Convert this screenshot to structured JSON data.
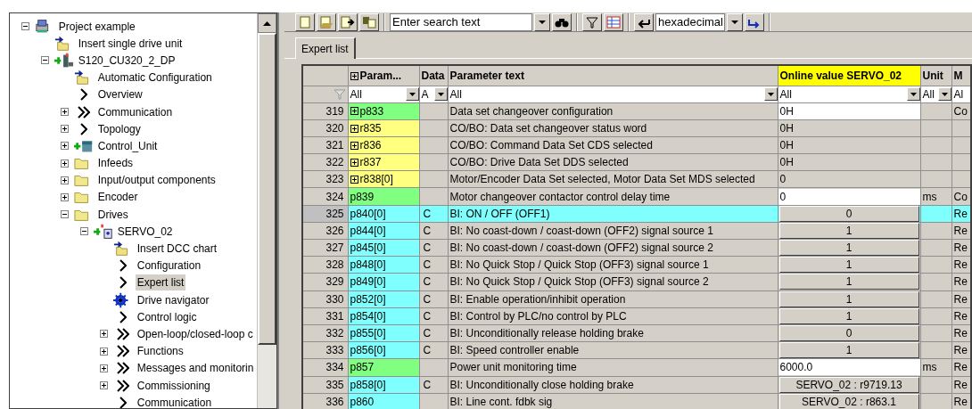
{
  "tree": [
    {
      "label": "Project example",
      "kind": "project",
      "expanded": true,
      "children": [
        {
          "label": "Insert single drive unit",
          "kind": "insert"
        },
        {
          "label": "S120_CU320_2_DP",
          "kind": "device",
          "expanded": true,
          "children": [
            {
              "label": "Automatic Configuration",
              "kind": "insert"
            },
            {
              "label": "Overview",
              "kind": "chevron"
            },
            {
              "label": "Communication",
              "kind": "double",
              "expanded": false
            },
            {
              "label": "Topology",
              "kind": "chevron",
              "expanded": false
            },
            {
              "label": "Control_Unit",
              "kind": "cu",
              "expanded": false
            },
            {
              "label": "Infeeds",
              "kind": "folder",
              "expanded": false
            },
            {
              "label": "Input/output components",
              "kind": "folder",
              "expanded": false
            },
            {
              "label": "Encoder",
              "kind": "folder",
              "expanded": false
            },
            {
              "label": "Drives",
              "kind": "folder",
              "expanded": true,
              "children": [
                {
                  "label": "SERVO_02",
                  "kind": "drive",
                  "expanded": true,
                  "children": [
                    {
                      "label": "Insert DCC chart",
                      "kind": "insert",
                      "selected": false
                    },
                    {
                      "label": "Configuration",
                      "kind": "chevron",
                      "selected": false
                    },
                    {
                      "label": "Expert list",
                      "kind": "chevron",
                      "selected": true
                    },
                    {
                      "label": "Drive navigator",
                      "kind": "gear",
                      "selected": false
                    },
                    {
                      "label": "Control logic",
                      "kind": "chevron",
                      "selected": false
                    },
                    {
                      "label": "Open-loop/closed-loop c",
                      "kind": "double",
                      "expanded": false,
                      "selected": false
                    },
                    {
                      "label": "Functions",
                      "kind": "double",
                      "expanded": false,
                      "selected": false
                    },
                    {
                      "label": "Messages and monitorin",
                      "kind": "double",
                      "expanded": false,
                      "selected": false
                    },
                    {
                      "label": "Commissioning",
                      "kind": "double",
                      "expanded": false,
                      "selected": false
                    },
                    {
                      "label": "Communication",
                      "kind": "chevron",
                      "selected": false
                    }
                  ]
                }
              ]
            }
          ]
        }
      ]
    }
  ],
  "toolbar": {
    "search": {
      "placeholder": "Enter search text"
    },
    "number_format": "hexadecimal"
  },
  "tab": {
    "label": "Expert list",
    "selected": true
  },
  "table": {
    "columns": [
      "Param...",
      "Data",
      "Parameter text",
      "Online value SERVO_02",
      "Unit",
      "M"
    ],
    "filters": [
      "All",
      "A",
      "All",
      "All",
      "All",
      "Al"
    ],
    "rows": [
      {
        "number": "319",
        "param": "p833",
        "expandable": true,
        "color": "#80ff80",
        "data": "",
        "text": "Data set changeover configuration",
        "value": "0H",
        "kind": "input",
        "unit": "",
        "column_7": "Co",
        "selected": false
      },
      {
        "number": "320",
        "param": "r835",
        "expandable": true,
        "color": "#ffff80",
        "data": "",
        "text": "CO/BO: Data set changeover status word",
        "value": "0H",
        "kind": "text",
        "unit": "",
        "column_7": "",
        "selected": false
      },
      {
        "number": "321",
        "param": "r836",
        "expandable": true,
        "color": "#ffff80",
        "data": "",
        "text": "CO/BO: Command Data Set CDS selected",
        "value": "0H",
        "kind": "text",
        "unit": "",
        "column_7": "",
        "selected": false
      },
      {
        "number": "322",
        "param": "r837",
        "expandable": true,
        "color": "#ffff80",
        "data": "",
        "text": "CO/BO: Drive Data Set DDS selected",
        "value": "0H",
        "kind": "text",
        "unit": "",
        "column_7": "",
        "selected": false
      },
      {
        "number": "323",
        "param": "r838[0]",
        "expandable": true,
        "color": "#ffff80",
        "data": "",
        "text": "Motor/Encoder Data Set selected, Motor Data Set MDS selected",
        "value": "0",
        "kind": "text",
        "unit": "",
        "column_7": "",
        "selected": false
      },
      {
        "number": "324",
        "param": "p839",
        "expandable": false,
        "color": "#80ff80",
        "data": "",
        "text": "Motor changeover contactor control delay time",
        "value": "0",
        "kind": "input",
        "unit": "ms",
        "column_7": "Co",
        "selected": false
      },
      {
        "number": "325",
        "param": "p840[0]",
        "expandable": false,
        "color": "#80ffff",
        "data": "C",
        "text": "BI: ON / OFF (OFF1)",
        "value": "0",
        "kind": "button",
        "unit": "",
        "column_7": "Re",
        "selected": true
      },
      {
        "number": "326",
        "param": "p844[0]",
        "expandable": false,
        "color": "#80ffff",
        "data": "C",
        "text": "BI: No coast-down / coast-down (OFF2) signal source 1",
        "value": "1",
        "kind": "button",
        "unit": "",
        "column_7": "Re",
        "selected": false
      },
      {
        "number": "327",
        "param": "p845[0]",
        "expandable": false,
        "color": "#80ffff",
        "data": "C",
        "text": "BI: No coast-down / coast-down (OFF2) signal source 2",
        "value": "1",
        "kind": "button",
        "unit": "",
        "column_7": "Re",
        "selected": false
      },
      {
        "number": "328",
        "param": "p848[0]",
        "expandable": false,
        "color": "#80ffff",
        "data": "C",
        "text": "BI: No Quick Stop / Quick Stop (OFF3) signal source 1",
        "value": "1",
        "kind": "button",
        "unit": "",
        "column_7": "Re",
        "selected": false
      },
      {
        "number": "329",
        "param": "p849[0]",
        "expandable": false,
        "color": "#80ffff",
        "data": "C",
        "text": "BI: No Quick Stop / Quick Stop (OFF3) signal source 2",
        "value": "1",
        "kind": "button",
        "unit": "",
        "column_7": "Re",
        "selected": false
      },
      {
        "number": "330",
        "param": "p852[0]",
        "expandable": false,
        "color": "#80ffff",
        "data": "C",
        "text": "BI: Enable operation/inhibit operation",
        "value": "1",
        "kind": "button",
        "unit": "",
        "column_7": "Re",
        "selected": false
      },
      {
        "number": "331",
        "param": "p854[0]",
        "expandable": false,
        "color": "#80ffff",
        "data": "C",
        "text": "BI: Control by PLC/no control by PLC",
        "value": "1",
        "kind": "button",
        "unit": "",
        "column_7": "Re",
        "selected": false
      },
      {
        "number": "332",
        "param": "p855[0]",
        "expandable": false,
        "color": "#80ffff",
        "data": "C",
        "text": "BI: Unconditionally release holding brake",
        "value": "0",
        "kind": "button",
        "unit": "",
        "column_7": "Re",
        "selected": false
      },
      {
        "number": "333",
        "param": "p856[0]",
        "expandable": false,
        "color": "#80ffff",
        "data": "C",
        "text": "BI: Speed controller enable",
        "value": "1",
        "kind": "button",
        "unit": "",
        "column_7": "Re",
        "selected": false
      },
      {
        "number": "334",
        "param": "p857",
        "expandable": false,
        "color": "#80ff80",
        "data": "",
        "text": "Power unit monitoring time",
        "value": "6000.0",
        "kind": "input",
        "unit": "ms",
        "column_7": "Re",
        "selected": false
      },
      {
        "number": "335",
        "param": "p858[0]",
        "expandable": false,
        "color": "#80ffff",
        "data": "C",
        "text": "BI: Unconditionally close holding brake",
        "value": "SERVO_02 : r9719.13",
        "kind": "button",
        "unit": "",
        "column_7": "Re",
        "selected": false
      },
      {
        "number": "336",
        "param": "p860",
        "expandable": false,
        "color": "#80ffff",
        "data": "",
        "text": "BI: Line cont. fdbk sig",
        "value": "SERVO_02 : r863.1",
        "kind": "button",
        "unit": "",
        "column_7": "Re",
        "selected": false
      }
    ]
  }
}
